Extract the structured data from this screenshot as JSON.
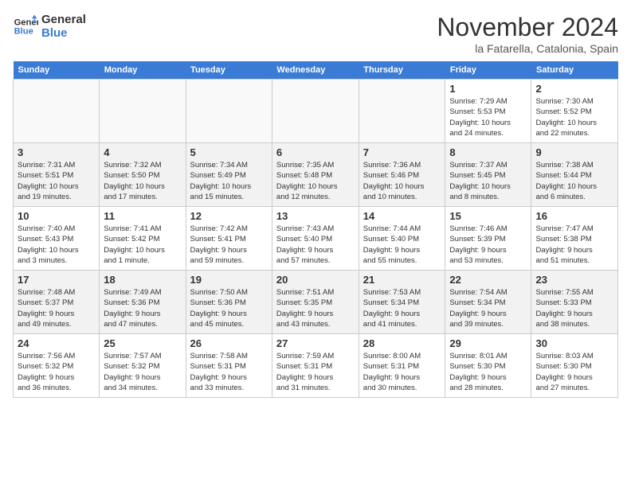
{
  "logo": {
    "line1": "General",
    "line2": "Blue"
  },
  "title": "November 2024",
  "subtitle": "la Fatarella, Catalonia, Spain",
  "headers": [
    "Sunday",
    "Monday",
    "Tuesday",
    "Wednesday",
    "Thursday",
    "Friday",
    "Saturday"
  ],
  "weeks": [
    [
      {
        "day": "",
        "info": ""
      },
      {
        "day": "",
        "info": ""
      },
      {
        "day": "",
        "info": ""
      },
      {
        "day": "",
        "info": ""
      },
      {
        "day": "",
        "info": ""
      },
      {
        "day": "1",
        "info": "Sunrise: 7:29 AM\nSunset: 5:53 PM\nDaylight: 10 hours\nand 24 minutes."
      },
      {
        "day": "2",
        "info": "Sunrise: 7:30 AM\nSunset: 5:52 PM\nDaylight: 10 hours\nand 22 minutes."
      }
    ],
    [
      {
        "day": "3",
        "info": "Sunrise: 7:31 AM\nSunset: 5:51 PM\nDaylight: 10 hours\nand 19 minutes."
      },
      {
        "day": "4",
        "info": "Sunrise: 7:32 AM\nSunset: 5:50 PM\nDaylight: 10 hours\nand 17 minutes."
      },
      {
        "day": "5",
        "info": "Sunrise: 7:34 AM\nSunset: 5:49 PM\nDaylight: 10 hours\nand 15 minutes."
      },
      {
        "day": "6",
        "info": "Sunrise: 7:35 AM\nSunset: 5:48 PM\nDaylight: 10 hours\nand 12 minutes."
      },
      {
        "day": "7",
        "info": "Sunrise: 7:36 AM\nSunset: 5:46 PM\nDaylight: 10 hours\nand 10 minutes."
      },
      {
        "day": "8",
        "info": "Sunrise: 7:37 AM\nSunset: 5:45 PM\nDaylight: 10 hours\nand 8 minutes."
      },
      {
        "day": "9",
        "info": "Sunrise: 7:38 AM\nSunset: 5:44 PM\nDaylight: 10 hours\nand 6 minutes."
      }
    ],
    [
      {
        "day": "10",
        "info": "Sunrise: 7:40 AM\nSunset: 5:43 PM\nDaylight: 10 hours\nand 3 minutes."
      },
      {
        "day": "11",
        "info": "Sunrise: 7:41 AM\nSunset: 5:42 PM\nDaylight: 10 hours\nand 1 minute."
      },
      {
        "day": "12",
        "info": "Sunrise: 7:42 AM\nSunset: 5:41 PM\nDaylight: 9 hours\nand 59 minutes."
      },
      {
        "day": "13",
        "info": "Sunrise: 7:43 AM\nSunset: 5:40 PM\nDaylight: 9 hours\nand 57 minutes."
      },
      {
        "day": "14",
        "info": "Sunrise: 7:44 AM\nSunset: 5:40 PM\nDaylight: 9 hours\nand 55 minutes."
      },
      {
        "day": "15",
        "info": "Sunrise: 7:46 AM\nSunset: 5:39 PM\nDaylight: 9 hours\nand 53 minutes."
      },
      {
        "day": "16",
        "info": "Sunrise: 7:47 AM\nSunset: 5:38 PM\nDaylight: 9 hours\nand 51 minutes."
      }
    ],
    [
      {
        "day": "17",
        "info": "Sunrise: 7:48 AM\nSunset: 5:37 PM\nDaylight: 9 hours\nand 49 minutes."
      },
      {
        "day": "18",
        "info": "Sunrise: 7:49 AM\nSunset: 5:36 PM\nDaylight: 9 hours\nand 47 minutes."
      },
      {
        "day": "19",
        "info": "Sunrise: 7:50 AM\nSunset: 5:36 PM\nDaylight: 9 hours\nand 45 minutes."
      },
      {
        "day": "20",
        "info": "Sunrise: 7:51 AM\nSunset: 5:35 PM\nDaylight: 9 hours\nand 43 minutes."
      },
      {
        "day": "21",
        "info": "Sunrise: 7:53 AM\nSunset: 5:34 PM\nDaylight: 9 hours\nand 41 minutes."
      },
      {
        "day": "22",
        "info": "Sunrise: 7:54 AM\nSunset: 5:34 PM\nDaylight: 9 hours\nand 39 minutes."
      },
      {
        "day": "23",
        "info": "Sunrise: 7:55 AM\nSunset: 5:33 PM\nDaylight: 9 hours\nand 38 minutes."
      }
    ],
    [
      {
        "day": "24",
        "info": "Sunrise: 7:56 AM\nSunset: 5:32 PM\nDaylight: 9 hours\nand 36 minutes."
      },
      {
        "day": "25",
        "info": "Sunrise: 7:57 AM\nSunset: 5:32 PM\nDaylight: 9 hours\nand 34 minutes."
      },
      {
        "day": "26",
        "info": "Sunrise: 7:58 AM\nSunset: 5:31 PM\nDaylight: 9 hours\nand 33 minutes."
      },
      {
        "day": "27",
        "info": "Sunrise: 7:59 AM\nSunset: 5:31 PM\nDaylight: 9 hours\nand 31 minutes."
      },
      {
        "day": "28",
        "info": "Sunrise: 8:00 AM\nSunset: 5:31 PM\nDaylight: 9 hours\nand 30 minutes."
      },
      {
        "day": "29",
        "info": "Sunrise: 8:01 AM\nSunset: 5:30 PM\nDaylight: 9 hours\nand 28 minutes."
      },
      {
        "day": "30",
        "info": "Sunrise: 8:03 AM\nSunset: 5:30 PM\nDaylight: 9 hours\nand 27 minutes."
      }
    ]
  ]
}
